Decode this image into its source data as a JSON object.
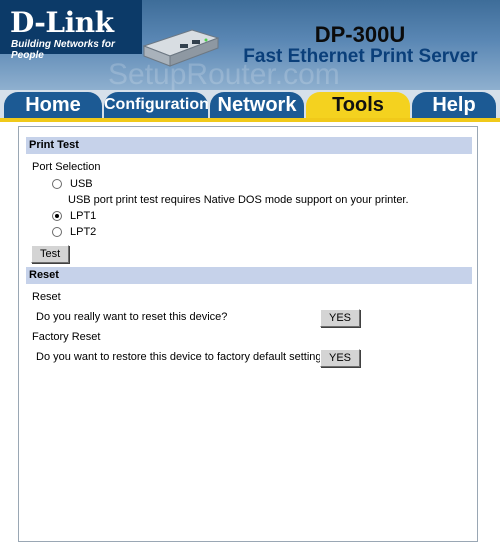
{
  "brand": {
    "logo": "D-Link",
    "tagline": "Building Networks for People"
  },
  "header": {
    "model": "DP-300U",
    "product": "Fast Ethernet Print Server",
    "watermark": "SetupRouter.com"
  },
  "nav": {
    "tabs": [
      {
        "label": "Home"
      },
      {
        "label": "Configuration"
      },
      {
        "label": "Network"
      },
      {
        "label": "Tools",
        "active": true
      },
      {
        "label": "Help"
      }
    ]
  },
  "print_test": {
    "title": "Print Test",
    "port_selection_label": "Port Selection",
    "options": [
      {
        "label": "USB",
        "selected": false
      },
      {
        "label": "LPT1",
        "selected": true
      },
      {
        "label": "LPT2",
        "selected": false
      }
    ],
    "usb_note": "USB port print test requires Native DOS mode support on your printer.",
    "test_button": "Test"
  },
  "reset": {
    "title": "Reset",
    "reset_label": "Reset",
    "reset_question": "Do you really want to reset this device?",
    "reset_button": "YES",
    "factory_label": "Factory Reset",
    "factory_question": "Do you want to restore this device to factory default setting?",
    "factory_button": "YES"
  },
  "colors": {
    "header_blue": "#3e6d99",
    "tab_blue": "#1c5a94",
    "active_tab": "#f4d21f",
    "section_head": "#c6d2ea"
  }
}
